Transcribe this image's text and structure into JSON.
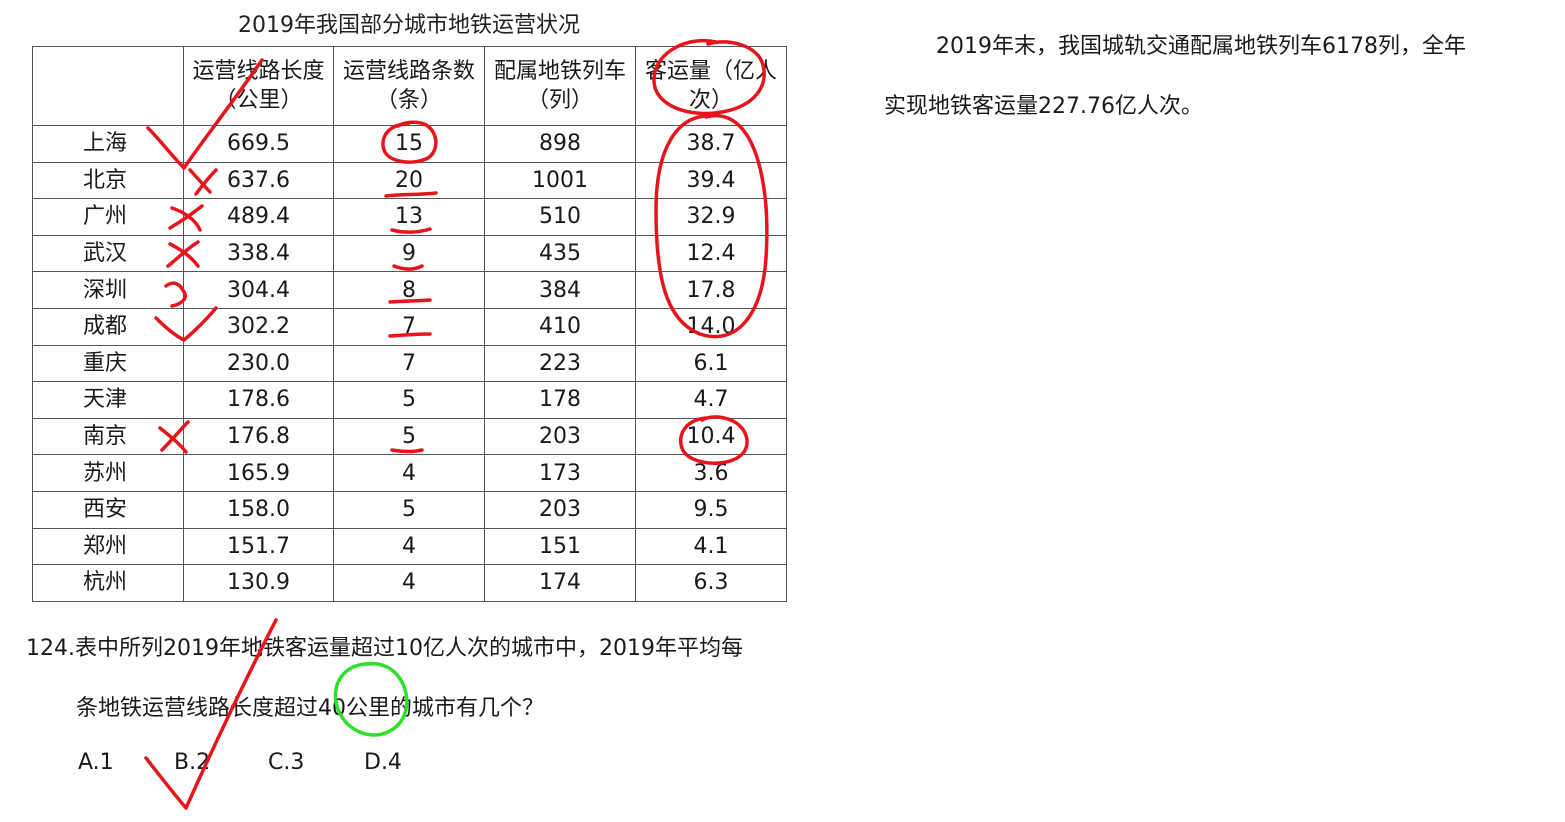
{
  "table": {
    "title": "2019年我国部分城市地铁运营状况",
    "headers": [
      "",
      "运营线路长度（公里）",
      "运营线路条数（条）",
      "配属地铁列车（列）",
      "客运量（亿人次）"
    ],
    "rows": [
      [
        "上海",
        "669.5",
        "15",
        "898",
        "38.7"
      ],
      [
        "北京",
        "637.6",
        "20",
        "1001",
        "39.4"
      ],
      [
        "广州",
        "489.4",
        "13",
        "510",
        "32.9"
      ],
      [
        "武汉",
        "338.4",
        "9",
        "435",
        "12.4"
      ],
      [
        "深圳",
        "304.4",
        "8",
        "384",
        "17.8"
      ],
      [
        "成都",
        "302.2",
        "7",
        "410",
        "14.0"
      ],
      [
        "重庆",
        "230.0",
        "7",
        "223",
        "6.1"
      ],
      [
        "天津",
        "178.6",
        "5",
        "178",
        "4.7"
      ],
      [
        "南京",
        "176.8",
        "5",
        "203",
        "10.4"
      ],
      [
        "苏州",
        "165.9",
        "4",
        "173",
        "3.6"
      ],
      [
        "西安",
        "158.0",
        "5",
        "203",
        "9.5"
      ],
      [
        "郑州",
        "151.7",
        "4",
        "151",
        "4.1"
      ],
      [
        "杭州",
        "130.9",
        "4",
        "174",
        "6.3"
      ]
    ]
  },
  "side_text": {
    "line1": "2019年末，我国城轨交通配属地铁列车6178列，全年",
    "line2": "实现地铁客运量227.76亿人次。"
  },
  "question": {
    "line1": "124.表中所列2019年地铁客运量超过10亿人次的城市中，2019年平均每",
    "line2": "条地铁运营线路长度超过40公里的城市有几个？",
    "options": [
      "A.1",
      "B.2",
      "C.3",
      "D.4"
    ]
  },
  "colors": {
    "ink_red": "#e8141b",
    "ink_green": "#2fe02a",
    "grid": "#555555"
  }
}
